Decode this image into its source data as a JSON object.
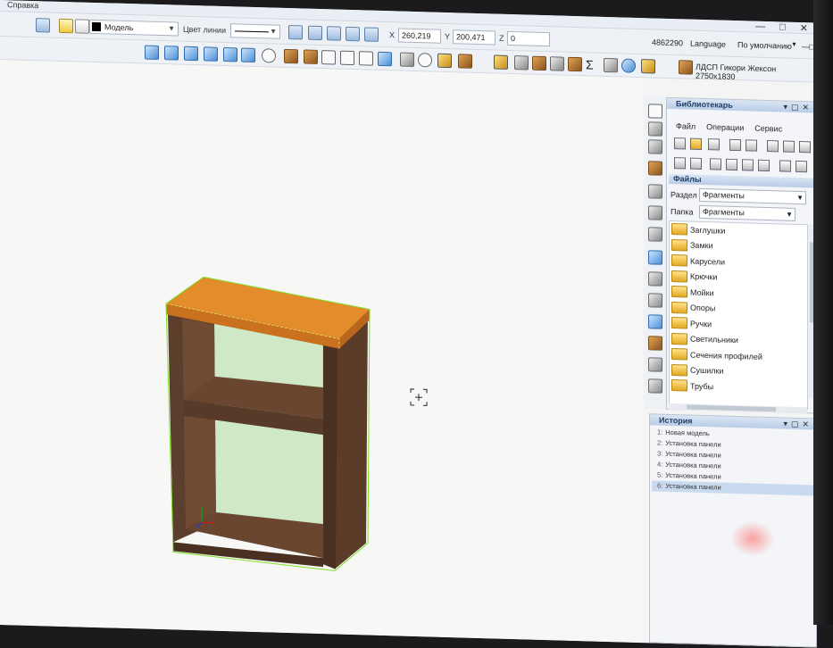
{
  "menubar": {
    "menu_item": "Справка"
  },
  "window_controls": {
    "minimize": "—",
    "maximize": "□",
    "close": "✕"
  },
  "toolbar": {
    "view_mode": "Модель",
    "line_color_label": "Цвет линии",
    "coord_x_label": "X",
    "coord_x_value": "260,219",
    "coord_y_label": "Y",
    "coord_y_value": "200,471",
    "coord_z_label": "Z",
    "coord_z_value": "0",
    "id_text": "4862290",
    "language_label": "Language",
    "default_label": "По умолчанию"
  },
  "material": {
    "label": "ЛДСП Гикори Жексон 2750х1830"
  },
  "library": {
    "title": "Библиотекарь",
    "menu": [
      "Файл",
      "Операции",
      "Сервис"
    ],
    "files_header": "Файлы",
    "section_label": "Раздел",
    "section_value": "Фрагменты",
    "folder_label": "Папка",
    "folder_value": "Фрагменты",
    "folders": [
      "Заглушки",
      "Замки",
      "Карусели",
      "Крючки",
      "Мойки",
      "Опоры",
      "Ручки",
      "Светильники",
      "Сечения профилей",
      "Сушилки",
      "Трубы"
    ]
  },
  "history": {
    "title": "История",
    "items": [
      {
        "num": "1:",
        "label": "Новая модель"
      },
      {
        "num": "2:",
        "label": "Установка панели"
      },
      {
        "num": "3:",
        "label": "Установка панели"
      },
      {
        "num": "4:",
        "label": "Установка панели"
      },
      {
        "num": "5:",
        "label": "Установка панели"
      },
      {
        "num": "6:",
        "label": "Установка панели"
      }
    ]
  },
  "colors": {
    "wood_top": "#e08a2a",
    "wood_dark": "#5a3d2a",
    "back_panel": "#cde8c4",
    "selection": "#7ee02a"
  }
}
